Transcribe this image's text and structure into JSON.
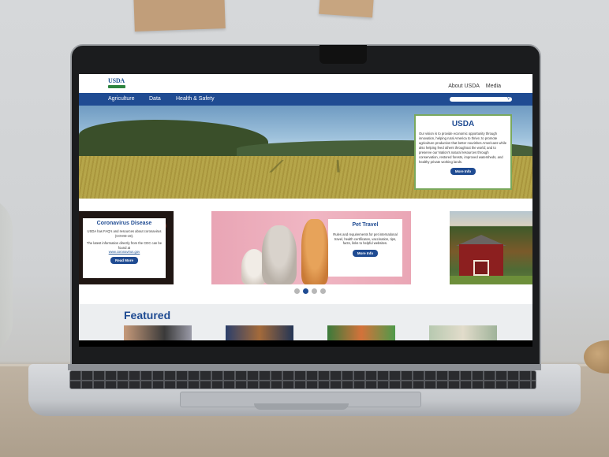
{
  "header": {
    "logo_text": "USDA",
    "util_links": [
      "About USDA",
      "Media"
    ]
  },
  "nav": {
    "items": [
      "Agriculture",
      "Data",
      "Health & Safety"
    ],
    "search_placeholder": ""
  },
  "hero": {
    "title": "USDA",
    "text": "Our vision is to provide economic opportunity through innovation, helping rural America to thrive; to promote agriculture production that better nourishes Americans while also helping feed others throughout the world; and to preserve our Nation's natural resources through conservation, restored forests, improved watersheds, and healthy private working lands.",
    "button": "More Info"
  },
  "cards": {
    "covid": {
      "title": "Coronavirus Disease",
      "text1": "USDA has FAQ's and resources about coronavirus (COVID-19).",
      "text2": "The latest information directly from the CDC can be found at",
      "link": "www.coronavirus.gov",
      "button": "Read More"
    },
    "pet": {
      "title": "Pet Travel",
      "text": "Rules and requirements for pet international travel, health certificates, vaccination, tips, facts, links to helpful websites.",
      "button": "More Info"
    }
  },
  "carousel": {
    "count": 4,
    "active_index": 1
  },
  "featured": {
    "title": "Featured"
  }
}
